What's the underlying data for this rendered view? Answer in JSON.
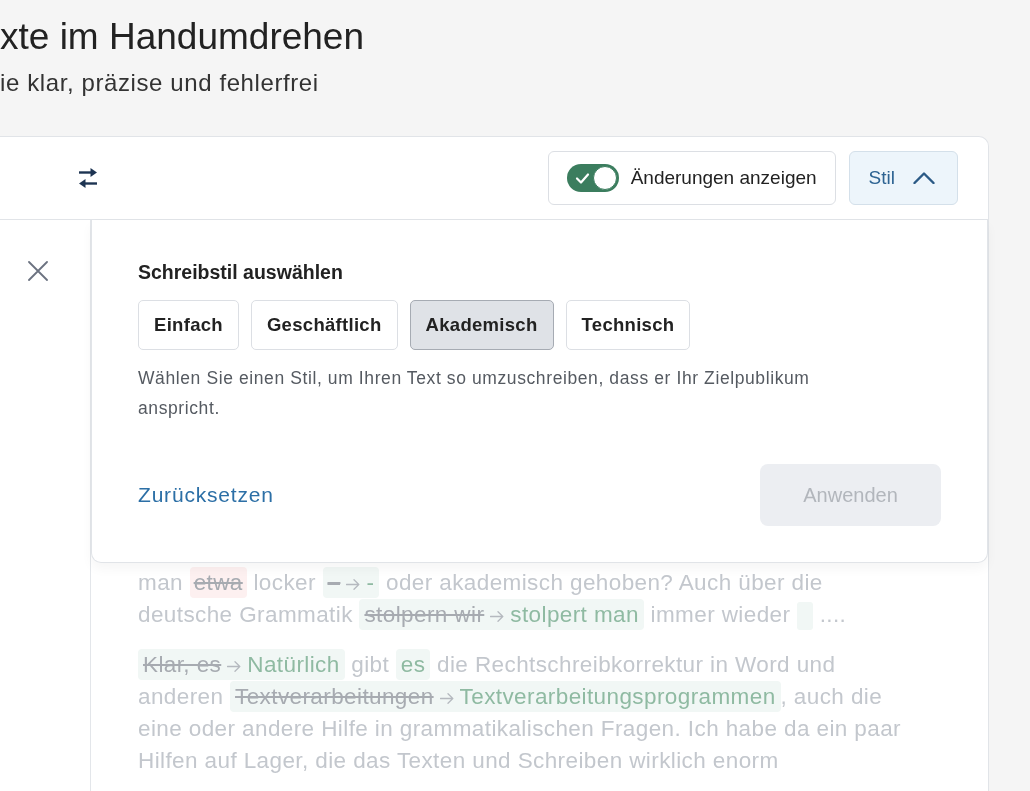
{
  "header": {
    "title": "xte im Handumdrehen",
    "subtitle": "ie klar, präzise und fehlerfrei"
  },
  "toolbar": {
    "show_changes": {
      "label": "Änderungen anzeigen",
      "on": true
    },
    "style_button": {
      "label": "Stil",
      "expanded": true
    }
  },
  "style_popup": {
    "heading": "Schreibstil auswählen",
    "styles": [
      {
        "label": "Einfach",
        "selected": false
      },
      {
        "label": "Geschäftlich",
        "selected": false
      },
      {
        "label": "Akademisch",
        "selected": true
      },
      {
        "label": "Technisch",
        "selected": false
      }
    ],
    "description": "Wählen Sie einen Stil, um Ihren Text so umzuschreiben, dass er Ihr Zielpublikum anspricht.",
    "reset_link": "Zurücksetzen",
    "apply_button": {
      "label": "Anwenden",
      "disabled": true
    }
  },
  "editor": {
    "paragraphs": [
      {
        "lines": [
          [
            {
              "kind": "text",
              "text": "man "
            },
            {
              "kind": "delete",
              "text": "etwa"
            },
            {
              "kind": "text",
              "text": " locker "
            },
            {
              "kind": "change",
              "from": "–",
              "to": "-"
            },
            {
              "kind": "text",
              "text": " oder akademisch gehoben? Auch über die"
            }
          ],
          [
            {
              "kind": "text",
              "text": "deutsche Grammatik "
            },
            {
              "kind": "change",
              "from": "stolpern wir",
              "to": "stolpert man"
            },
            {
              "kind": "text",
              "text": " immer wieder "
            },
            {
              "kind": "marker"
            },
            {
              "kind": "text",
              "text": " ...."
            }
          ]
        ]
      },
      {
        "lines": [
          [
            {
              "kind": "change",
              "from": "Klar, es",
              "to": "Natürlich"
            },
            {
              "kind": "text",
              "text": " gibt "
            },
            {
              "kind": "insert",
              "text": "es"
            },
            {
              "kind": "text",
              "text": " die Rechtschreibkorrektur in Word und"
            }
          ],
          [
            {
              "kind": "text",
              "text": "anderen "
            },
            {
              "kind": "change",
              "from": "Textverarbeitungen",
              "to": "Textverarbeitungsprogrammen"
            },
            {
              "kind": "text",
              "text": ", auch die"
            }
          ],
          [
            {
              "kind": "text",
              "text": "eine oder andere Hilfe in grammatikalischen Fragen. Ich habe da ein paar"
            }
          ],
          [
            {
              "kind": "text",
              "text": "Hilfen auf Lager, die das Texten und Schreiben wirklich enorm"
            }
          ]
        ]
      }
    ]
  }
}
